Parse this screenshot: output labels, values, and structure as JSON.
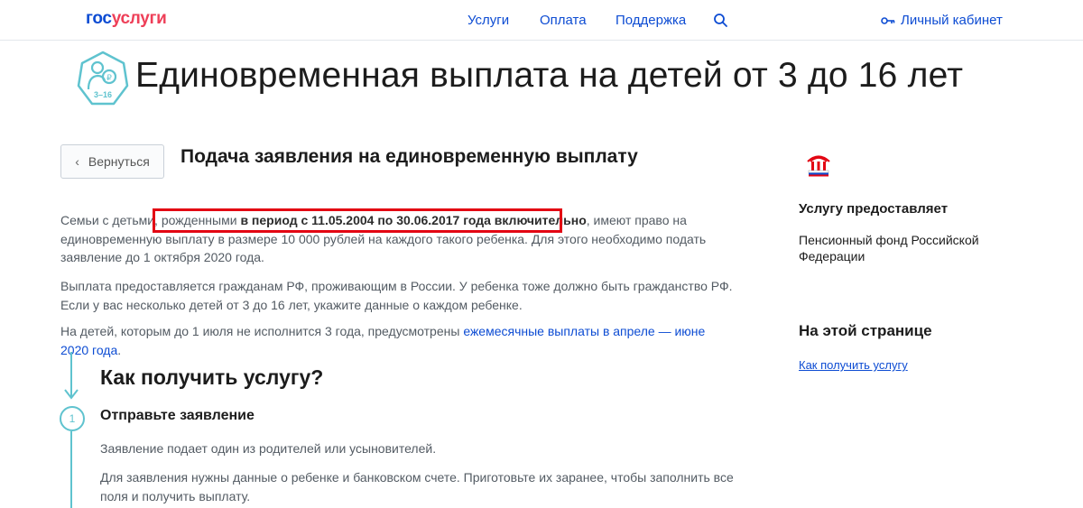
{
  "header": {
    "logo_part1": "гос",
    "logo_part2": "услуги",
    "nav": {
      "services": "Услуги",
      "payment": "Оплата",
      "support": "Поддержка"
    },
    "cabinet": "Личный кабинет"
  },
  "hero": {
    "icon_label": "3–16",
    "title": "Единовременная выплата на детей от 3 до 16 лет"
  },
  "back_button": "Вернуться",
  "sub_title": "Подача заявления на единовременную выплату",
  "paragraphs": {
    "p1_a": "Семьи с детьми, рожденными ",
    "p1_b": "в период с 11.05.2004 по 30.06.2017 года включительно",
    "p1_c": ", имеют право на единовременную выплату в размере 10 000 рублей на каждого такого ребенка. Для этого необходимо подать заявление до 1 октября 2020 года.",
    "p2": "Выплата предоставляется гражданам РФ, проживающим в России. У ребенка тоже должно быть гражданство РФ. Если у вас несколько детей от 3 до 16 лет, укажите данные о каждом ребенке.",
    "p3_a": "На детей, которым до 1 июля не исполнится 3 года, предусмотрены ",
    "p3_link": "ежемесячные выплаты в апреле — июне 2020 года",
    "p3_c": "."
  },
  "steps": {
    "how_title": "Как получить услугу?",
    "step1_number": "1",
    "step1_title": "Отправьте заявление",
    "step1_text1": "Заявление подает один из родителей или усыновителей.",
    "step1_text2": "Для заявления нужны данные о ребенке и банковском счете. Приготовьте их заранее, чтобы заполнить все поля и получить выплату."
  },
  "sidebar": {
    "provider_heading": "Услугу предоставляет",
    "provider_name": "Пенсионный фонд Российской Федерации",
    "on_page_heading": "На этой странице",
    "on_page_link": "Как получить услугу"
  },
  "colors": {
    "brand_blue": "#0d4cd3",
    "brand_red": "#ee3f58",
    "accent_teal": "#5fc3cf",
    "highlight_red": "#e30613"
  },
  "icons": {
    "search": "search-icon",
    "key": "key-icon",
    "back": "chevron-left-icon",
    "hero": "child-coin-icon",
    "pfr": "pfr-logo-icon",
    "arrow": "arrow-down-icon"
  }
}
